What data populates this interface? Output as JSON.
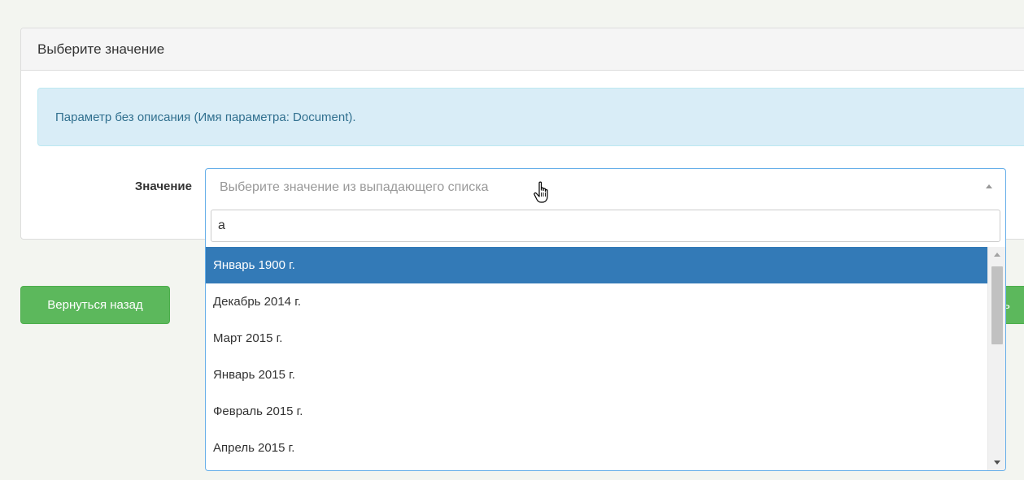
{
  "panel": {
    "title": "Выберите значение"
  },
  "info": {
    "text": "Параметр без описания (Имя параметра: Document)."
  },
  "form": {
    "field_label": "Значение",
    "select_placeholder": "Выберите значение из выпадающего списка",
    "search_value": "а",
    "options": [
      {
        "label": "Январь 1900 г.",
        "selected": true
      },
      {
        "label": "Декабрь 2014 г.",
        "selected": false
      },
      {
        "label": "Март 2015 г.",
        "selected": false
      },
      {
        "label": "Январь 2015 г.",
        "selected": false
      },
      {
        "label": "Февраль 2015 г.",
        "selected": false
      },
      {
        "label": "Апрель 2015 г.",
        "selected": false
      }
    ]
  },
  "buttons": {
    "back_label": "Вернуться назад",
    "right_partial_label": "ь"
  },
  "icons": {
    "select_arrow": "chevron-up-icon",
    "cursor": "hand-pointer-icon"
  },
  "colors": {
    "primary": "#337ab7",
    "success": "#5cb85c",
    "info_bg": "#d9edf7",
    "info_text": "#31708f",
    "focus_border": "#66afe9"
  }
}
